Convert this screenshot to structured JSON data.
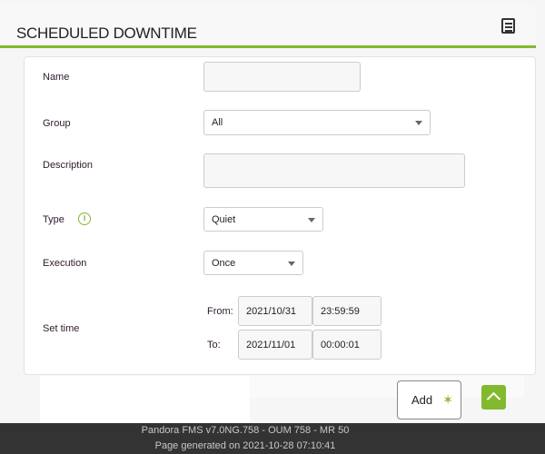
{
  "header": {
    "title": "SCHEDULED DOWNTIME",
    "list_icon": "list-icon"
  },
  "form": {
    "name": {
      "label": "Name",
      "value": ""
    },
    "group": {
      "label": "Group",
      "value": "All"
    },
    "description": {
      "label": "Description",
      "value": ""
    },
    "type": {
      "label": "Type",
      "value": "Quiet",
      "info_icon": "info-icon"
    },
    "execution": {
      "label": "Execution",
      "value": "Once"
    },
    "set_time": {
      "label": "Set time",
      "from_label": "From:",
      "from_date": "2021/10/31",
      "from_time": "23:59:59",
      "to_label": "To:",
      "to_date": "2021/11/01",
      "to_time": "00:00:01"
    }
  },
  "actions": {
    "add_label": "Add",
    "add_icon": "wand-icon",
    "scroll_top_icon": "chevron-up-icon"
  },
  "footer": {
    "version": "Pandora FMS v7.0NG.758 - OUM 758 - MR 50",
    "generated": "Page generated on 2021-10-28 07:10:41"
  },
  "colors": {
    "accent": "#82b92e",
    "footer_bg": "#333333"
  }
}
